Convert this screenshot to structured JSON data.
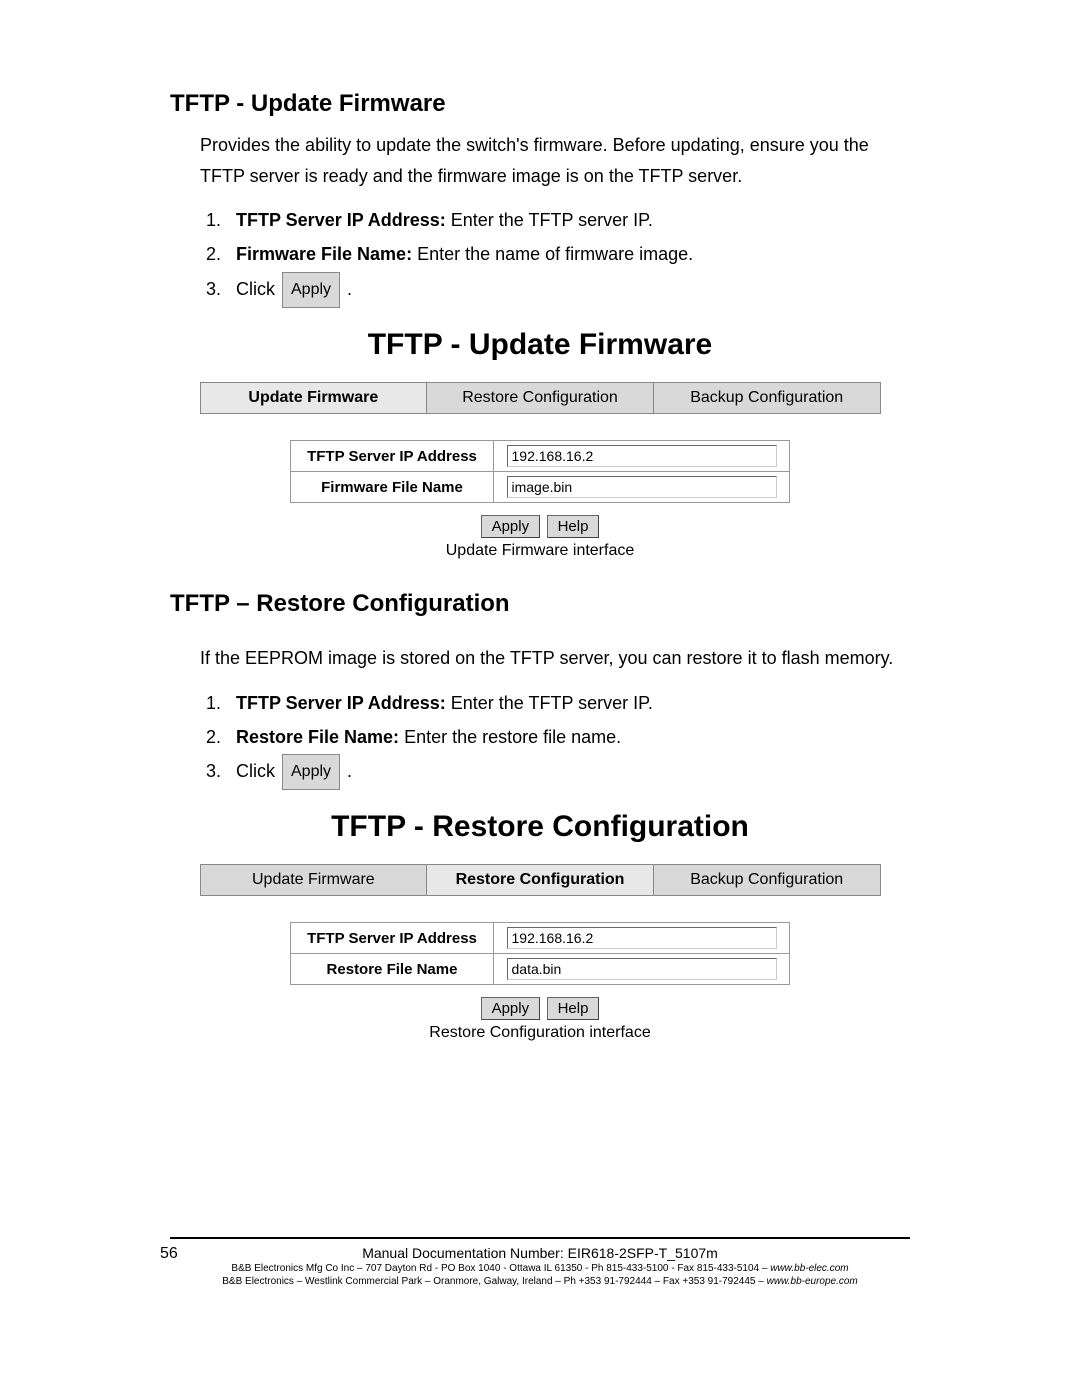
{
  "section1": {
    "heading": "TFTP - Update Firmware",
    "intro": "Provides the ability to update the switch's firmware. Before updating, ensure you the TFTP server is ready and the firmware image is on the TFTP server.",
    "steps": [
      {
        "bold": "TFTP Server IP Address:",
        "rest": " Enter the TFTP server IP."
      },
      {
        "bold": "Firmware File Name:",
        "rest": "   Enter the name of firmware image."
      },
      {
        "bold": "",
        "rest": "Click ",
        "button": "Apply",
        "tail": " ."
      }
    ]
  },
  "fig1": {
    "title": "TFTP - Update Firmware",
    "tabs": [
      "Update Firmware",
      "Restore Configuration",
      "Backup Configuration"
    ],
    "active_tab": 0,
    "rows": [
      {
        "label": "TFTP Server IP Address",
        "value": "192.168.16.2"
      },
      {
        "label": "Firmware File Name",
        "value": "image.bin"
      }
    ],
    "buttons": [
      "Apply",
      "Help"
    ],
    "caption": "Update Firmware interface"
  },
  "section2": {
    "heading": "TFTP – Restore Configuration",
    "intro": "If the EEPROM image is stored on the TFTP server, you can restore it to flash memory.",
    "steps": [
      {
        "bold": "TFTP Server IP Address:",
        "rest": " Enter the TFTP server IP."
      },
      {
        "bold": "Restore File Name:",
        "rest": " Enter the restore file name."
      },
      {
        "bold": "",
        "rest": "Click ",
        "button": "Apply",
        "tail": " ."
      }
    ]
  },
  "fig2": {
    "title": "TFTP - Restore Configuration",
    "tabs": [
      "Update Firmware",
      "Restore Configuration",
      "Backup Configuration"
    ],
    "active_tab": 1,
    "rows": [
      {
        "label": "TFTP Server IP Address",
        "value": "192.168.16.2"
      },
      {
        "label": "Restore File Name",
        "value": "data.bin"
      }
    ],
    "buttons": [
      "Apply",
      "Help"
    ],
    "caption": "Restore Configuration interface"
  },
  "footer": {
    "page": "56",
    "line1": "Manual Documentation Number: EIR618-2SFP-T_5107m",
    "line2_a": "B&B Electronics Mfg Co Inc – 707 Dayton Rd - PO Box 1040 - Ottawa IL 61350 - Ph 815-433-5100 - Fax 815-433-5104 – ",
    "line2_b": "www.bb-elec.com",
    "line3_a": "B&B Electronics – Westlink Commercial Park – Oranmore, Galway, Ireland – Ph +353 91-792444 – Fax +353 91-792445 – ",
    "line3_b": "www.bb-europe.com"
  }
}
